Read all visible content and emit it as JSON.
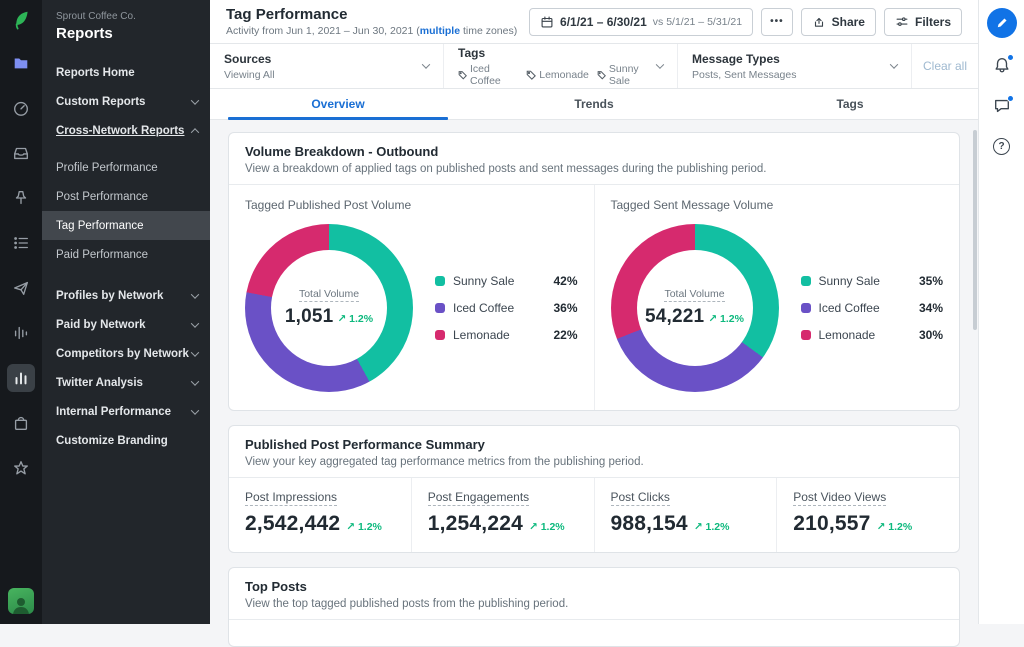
{
  "sidebar": {
    "org": "Sprout Coffee Co.",
    "section_title": "Reports",
    "items": [
      {
        "label": "Reports Home"
      },
      {
        "label": "Custom Reports"
      },
      {
        "label": "Cross-Network Reports"
      },
      {
        "label": "Profile Performance"
      },
      {
        "label": "Post Performance"
      },
      {
        "label": "Tag Performance"
      },
      {
        "label": "Paid Performance"
      },
      {
        "label": "Profiles by Network"
      },
      {
        "label": "Paid by Network"
      },
      {
        "label": "Competitors by Network"
      },
      {
        "label": "Twitter Analysis"
      },
      {
        "label": "Internal Performance"
      },
      {
        "label": "Customize Branding"
      }
    ]
  },
  "header": {
    "title": "Tag Performance",
    "subtitle_prefix": "Activity from Jun 1, 2021 – Jun 30, 2021 (",
    "subtitle_link": "multiple",
    "subtitle_suffix": " time zones)",
    "date_primary": "6/1/21 – 6/30/21",
    "date_compare": "vs 5/1/21 – 5/31/21",
    "more_label": "•••",
    "share_label": "Share",
    "filters_label": "Filters"
  },
  "filter_bar": {
    "sources_label": "Sources",
    "sources_value": "Viewing All",
    "tags_label": "Tags",
    "tag_values": [
      "Iced Coffee",
      "Lemonade",
      "Sunny Sale"
    ],
    "message_types_label": "Message Types",
    "message_types_value": "Posts, Sent Messages",
    "clear_all_label": "Clear all"
  },
  "tabs": [
    {
      "label": "Overview"
    },
    {
      "label": "Trends"
    },
    {
      "label": "Tags"
    }
  ],
  "volume_card": {
    "title": "Volume Breakdown - Outbound",
    "description": "View a breakdown of applied tags on published posts and sent messages during the publishing period."
  },
  "chart_data": [
    {
      "type": "pie",
      "title": "Tagged Published Post Volume",
      "center_label": "Total Volume",
      "total": "1,051",
      "delta": "↗ 1.2%",
      "legend_position": "right",
      "slices": [
        {
          "label": "Sunny Sale",
          "value": 42,
          "pct": "42%",
          "color": "#12BFA2"
        },
        {
          "label": "Iced Coffee",
          "value": 36,
          "pct": "36%",
          "color": "#6A51C6"
        },
        {
          "label": "Lemonade",
          "value": 22,
          "pct": "22%",
          "color": "#D62A6E"
        }
      ]
    },
    {
      "type": "pie",
      "title": "Tagged Sent Message Volume",
      "center_label": "Total Volume",
      "total": "54,221",
      "delta": "↗ 1.2%",
      "legend_position": "right",
      "slices": [
        {
          "label": "Sunny Sale",
          "value": 35,
          "pct": "35%",
          "color": "#12BFA2"
        },
        {
          "label": "Iced Coffee",
          "value": 34,
          "pct": "34%",
          "color": "#6A51C6"
        },
        {
          "label": "Lemonade",
          "value": 30,
          "pct": "30%",
          "color": "#D62A6E"
        }
      ]
    }
  ],
  "summary_card": {
    "title": "Published Post Performance Summary",
    "description": "View your key aggregated tag performance metrics from the publishing period.",
    "metrics": [
      {
        "label": "Post Impressions",
        "value": "2,542,442",
        "delta": "↗ 1.2%"
      },
      {
        "label": "Post Engagements",
        "value": "1,254,224",
        "delta": "↗ 1.2%"
      },
      {
        "label": "Post Clicks",
        "value": "988,154",
        "delta": "↗ 1.2%"
      },
      {
        "label": "Post Video Views",
        "value": "210,557",
        "delta": "↗ 1.2%"
      }
    ]
  },
  "top_posts_card": {
    "title": "Top Posts",
    "description": "View the top tagged published posts from the publishing period."
  },
  "colors": {
    "accent_blue": "#1A6FD4",
    "teal": "#12BFA2",
    "purple": "#6A51C6",
    "magenta": "#D62A6E",
    "delta_green": "#0EB97E",
    "sprout_green": "#2DB557"
  }
}
